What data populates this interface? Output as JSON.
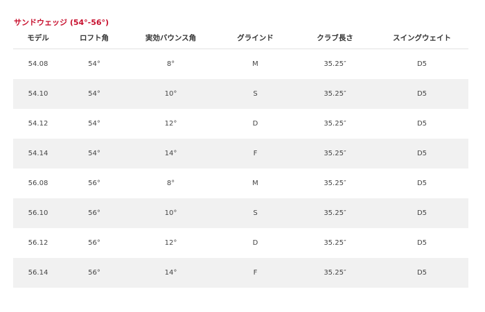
{
  "section": {
    "title": "サンドウェッジ (54°-56°)"
  },
  "table": {
    "columns": [
      "モデル",
      "ロフト角",
      "実効バウンス角",
      "グラインド",
      "クラブ長さ",
      "スイングウェイト"
    ],
    "rows": [
      [
        "54.08",
        "54°",
        "8°",
        "M",
        "35.25″",
        "D5"
      ],
      [
        "54.10",
        "54°",
        "10°",
        "S",
        "35.25″",
        "D5"
      ],
      [
        "54.12",
        "54°",
        "12°",
        "D",
        "35.25″",
        "D5"
      ],
      [
        "54.14",
        "54°",
        "14°",
        "F",
        "35.25″",
        "D5"
      ],
      [
        "56.08",
        "56°",
        "8°",
        "M",
        "35.25″",
        "D5"
      ],
      [
        "56.10",
        "56°",
        "10°",
        "S",
        "35.25″",
        "D5"
      ],
      [
        "56.12",
        "56°",
        "12°",
        "D",
        "35.25″",
        "D5"
      ],
      [
        "56.14",
        "56°",
        "14°",
        "F",
        "35.25″",
        "D5"
      ]
    ]
  },
  "colors": {
    "title": "#c8102e",
    "stripe": "#f1f1f1"
  }
}
